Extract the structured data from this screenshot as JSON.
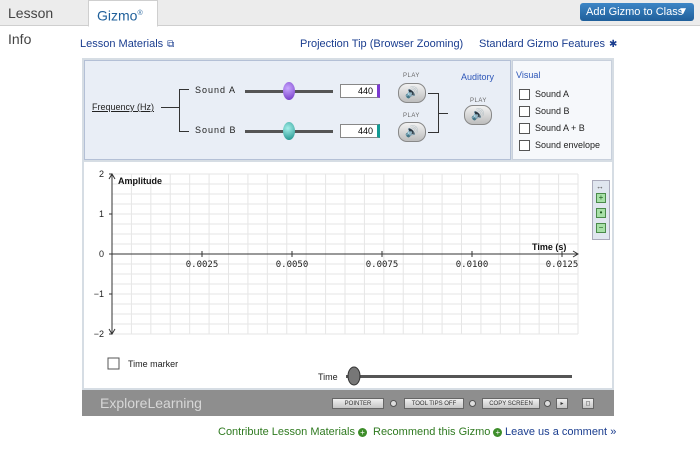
{
  "tabs": [
    {
      "label": "Lesson Info"
    },
    {
      "label": "Gizmo",
      "mark": "®"
    }
  ],
  "add_button": {
    "label": "Add Gizmo to Class"
  },
  "links": {
    "lesson_materials": "Lesson Materials",
    "projection_tip": "Projection Tip (Browser Zooming)",
    "standard_features": "Standard Gizmo Features"
  },
  "controls": {
    "frequency_label": "Frequency (Hz)",
    "sound_a_label": "Sound A",
    "sound_b_label": "Sound B",
    "sound_a_value": "440",
    "sound_b_value": "440",
    "play_label": "PLAY",
    "auditory_label": "Auditory",
    "slider_a_fraction": 0.5,
    "slider_b_fraction": 0.5
  },
  "visual": {
    "title": "Visual",
    "options": [
      {
        "label": "Sound A",
        "checked": false
      },
      {
        "label": "Sound B",
        "checked": false
      },
      {
        "label": "Sound A + B",
        "checked": false
      },
      {
        "label": "Sound envelope",
        "checked": false
      }
    ]
  },
  "graph": {
    "y_label": "Amplitude",
    "x_label": "Time (s)",
    "y_ticks": [
      "2",
      "1",
      "0",
      "−1",
      "−2"
    ],
    "x_ticks": [
      "0.0025",
      "0.0050",
      "0.0075",
      "0.0100",
      "0.0125"
    ],
    "time_marker_label": "Time marker",
    "time_slider_label": "Time",
    "time_slider_fraction": 0.0
  },
  "bottom_bar": {
    "brand": "ExploreLearning",
    "pointer_label": "POINTER",
    "tooltips_label": "TOOL TIPS OFF",
    "copy_screen_label": "COPY SCREEN"
  },
  "footer": {
    "contribute": "Contribute Lesson Materials",
    "recommend": "Recommend this Gizmo",
    "comment": "Leave us a comment"
  },
  "colors": {
    "accent": "#1f5f9a",
    "sound_a": "#7a3ad0",
    "sound_b": "#129a94",
    "green_link": "#2f7a20"
  }
}
